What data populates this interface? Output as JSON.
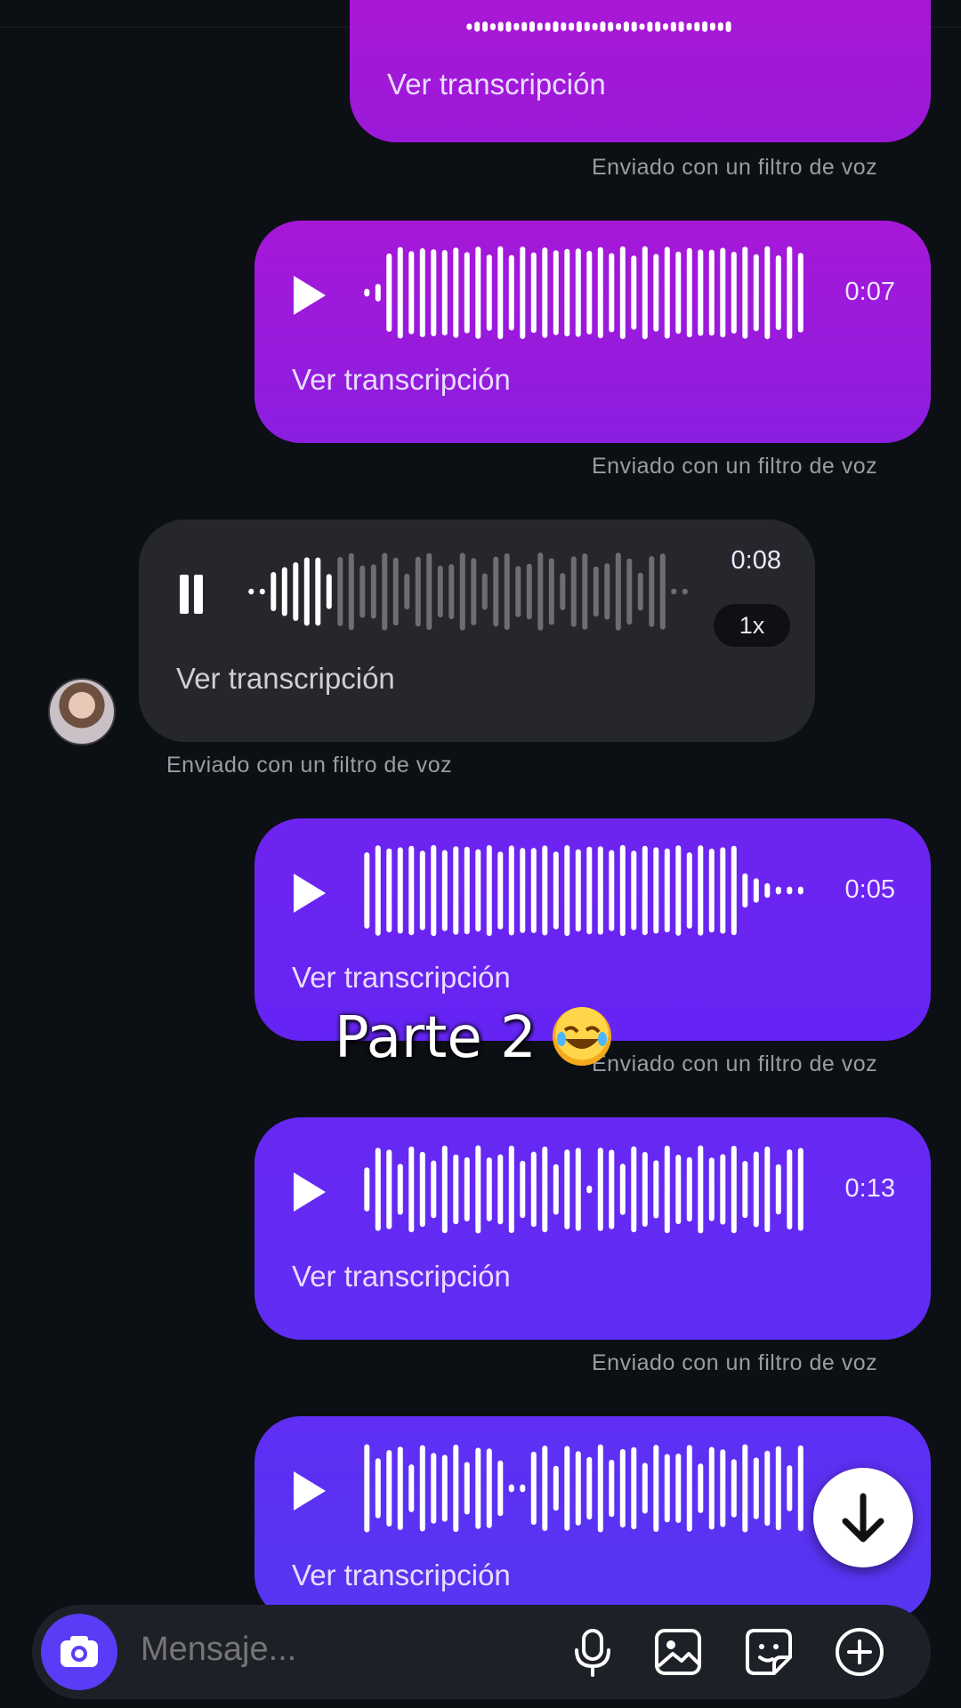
{
  "messages": [
    {
      "side": "out",
      "duration": "",
      "transcript_label": "Ver transcripción",
      "caption": "Enviado con un filtro de voz",
      "gradient": [
        "#b516d3",
        "#9a19d9"
      ]
    },
    {
      "side": "out",
      "duration": "0:07",
      "transcript_label": "Ver transcripción",
      "caption": "Enviado con un filtro de voz",
      "gradient": [
        "#a717d8",
        "#8b1ee0"
      ]
    },
    {
      "side": "in",
      "duration": "0:08",
      "speed": "1x",
      "transcript_label": "Ver transcripción",
      "caption": "Enviado con un filtro de voz",
      "state": "playing"
    },
    {
      "side": "out",
      "duration": "0:05",
      "transcript_label": "Ver transcripción",
      "caption": "Enviado con un filtro de voz",
      "gradient": [
        "#6e24f0",
        "#6524f4"
      ]
    },
    {
      "side": "out",
      "duration": "0:13",
      "transcript_label": "Ver transcripción",
      "caption": "Enviado con un filtro de voz",
      "gradient": [
        "#6728f3",
        "#5f2df4"
      ]
    },
    {
      "side": "out",
      "duration": "",
      "transcript_label": "Ver transcripción",
      "caption": "",
      "gradient": [
        "#5f2ef4",
        "#5636f2"
      ]
    }
  ],
  "overlay_text": "Parte 2",
  "composer": {
    "placeholder": "Mensaje..."
  },
  "icons": {
    "camera": "camera-icon",
    "mic": "microphone-icon",
    "gallery": "gallery-icon",
    "sticker": "sticker-icon",
    "plus": "plus-circle-icon",
    "scroll": "arrow-down-icon"
  },
  "colors": {
    "background": "#0c0f14",
    "incoming_bubble": "#26272c",
    "composer": "#1e2028",
    "camera_button": "#5b3cf6"
  }
}
